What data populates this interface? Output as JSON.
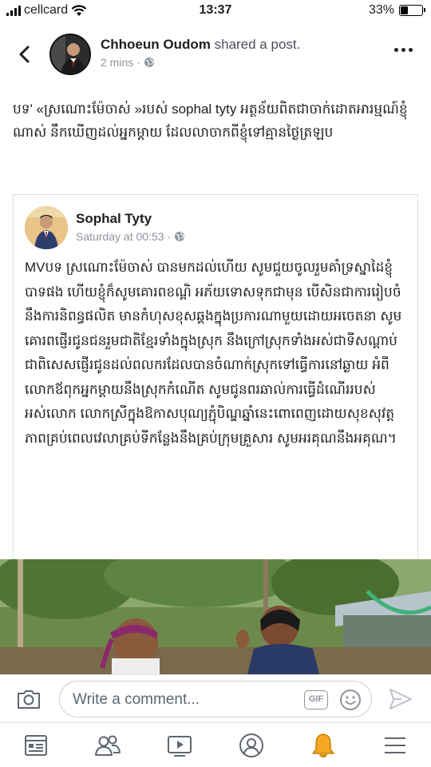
{
  "status_bar": {
    "carrier": "cellcard",
    "time": "13:37",
    "battery": "33%",
    "battery_level": 0.33
  },
  "post": {
    "author": "Chhoeun Oudom",
    "action": "shared a post.",
    "time": "2 mins",
    "privacy_icon": "globe-icon",
    "text": "បទ' «ស្រណោះម៉ែចាស់ »របស់ sophal tyty អត្ថន័យពិតជាចាក់ដោតអារម្មណ៍ខ្ញុំណាស់ នឹកឃើញដល់អ្នកម្ដាយ ដែលលាចាកពីខ្ញុំទៅគ្មានថ្ងៃត្រឡប"
  },
  "shared_post": {
    "author": "Sophal Tyty",
    "time": "Saturday at 00:53",
    "privacy_icon": "globe-icon",
    "text": "MVបទ ស្រណោះម៉ែចាស់ បានមកដល់ហើយ សូមជួយចូលរួមគាំទ្រស្នាដៃខ្ញុំបាទផង ហើយខ្ញុំក៏សូមគោរពខណ្ដិ អភ័យទោសទុកជាមុន បើសិនជាការរៀបចំនឹងការនិពន្ធផលិត មានកំហុសខុសឆ្គងក្នុងប្រការណាមួយដោយអចេតនា សូមគោរពផ្ញើរជូនជនរួមជាតិខ្មែរទាំងក្នុងស្រុក នឹងក្រៅស្រុកទាំងអស់ជាទីសណ្ដាប់ ជាពិសេសផ្ញើរជូនដល់ពលករដែលបានចំណាក់ស្រុកទៅធ្វើការនៅឆ្ងាយ អំពីលោកឪពុកអ្នកម្ដាយនឹងស្រុកកំណើត សូមជូនពរឆាល់ការធ្វើដំណើររបស់អស់លោក លោកស្រីក្នុងឱកាសបុណ្យភ្ជុំបិណ្ឌឆ្នាំនេះពោពេញដោយសុខសុវត្តភាពគ្រប់ពេលវេលាគ្រប់ទីកន្លែងនឹងគ្រប់ក្រុមគ្រួសារ សូមអរគុណនឹងអគុណ។"
  },
  "comment_bar": {
    "placeholder": "Write a comment...",
    "gif_label": "GIF"
  },
  "bottom_nav": [
    {
      "icon": "news-feed-icon"
    },
    {
      "icon": "friends-icon"
    },
    {
      "icon": "watch-icon"
    },
    {
      "icon": "profile-icon"
    },
    {
      "icon": "notifications-bell-icon",
      "color": "#f5a623"
    },
    {
      "icon": "menu-icon"
    }
  ],
  "colors": {
    "accent": "#4267b2",
    "meta": "#90949c",
    "bell": "#f5a623"
  }
}
